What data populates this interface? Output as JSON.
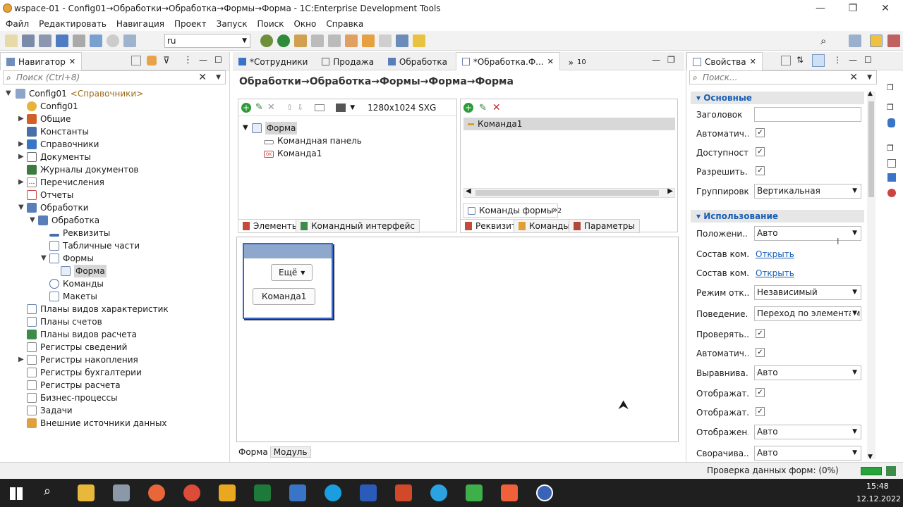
{
  "window": {
    "title": "wspace-01 - Config01→Обработки→Обработка→Формы→Форма - 1C:Enterprise Development Tools"
  },
  "menu": [
    "Файл",
    "Редактировать",
    "Навигация",
    "Проект",
    "Запуск",
    "Поиск",
    "Окно",
    "Справка"
  ],
  "toolbar": {
    "language": "ru"
  },
  "navigator": {
    "tab": "Навигатор",
    "search_placeholder": "Поиск (Ctrl+8)",
    "root": "Config01",
    "root_suffix": "<Справочники>",
    "items": [
      {
        "label": "Config01"
      },
      {
        "label": "Общие"
      },
      {
        "label": "Константы"
      },
      {
        "label": "Справочники"
      },
      {
        "label": "Документы"
      },
      {
        "label": "Журналы документов"
      },
      {
        "label": "Перечисления"
      },
      {
        "label": "Отчеты"
      },
      {
        "label": "Обработки"
      },
      {
        "label": "Обработка"
      },
      {
        "label": "Реквизиты"
      },
      {
        "label": "Табличные части"
      },
      {
        "label": "Формы"
      },
      {
        "label": "Форма"
      },
      {
        "label": "Команды"
      },
      {
        "label": "Макеты"
      },
      {
        "label": "Планы видов характеристик"
      },
      {
        "label": "Планы счетов"
      },
      {
        "label": "Планы видов расчета"
      },
      {
        "label": "Регистры сведений"
      },
      {
        "label": "Регистры накопления"
      },
      {
        "label": "Регистры бухгалтерии"
      },
      {
        "label": "Регистры расчета"
      },
      {
        "label": "Бизнес-процессы"
      },
      {
        "label": "Задачи"
      },
      {
        "label": "Внешние источники данных"
      }
    ]
  },
  "editor": {
    "tabs": [
      "*Сотрудники",
      "Продажа",
      "Обработка",
      "*Обработка.Ф...",
      "10"
    ],
    "breadcrumb": "Обработки→Обработка→Формы→Форма→Форма",
    "resolution": "1280x1024 SXG",
    "tree": [
      "Форма",
      "Командная панель",
      "Команда1"
    ],
    "left_tabs": [
      "Элементы",
      "Командный интерфейс"
    ],
    "command_list": [
      "Команда1"
    ],
    "command_sub_tab": "Команды формы",
    "command_sub_more": "2",
    "right_tabs": [
      "Реквизит",
      "Команды",
      "Параметры"
    ],
    "preview": {
      "more_button": "Ещё",
      "command_button": "Команда1"
    },
    "bottom_tabs": [
      "Форма",
      "Модуль"
    ]
  },
  "properties": {
    "tab": "Свойства",
    "search_placeholder": "Поиск...",
    "section_main": "Основные",
    "section_usage": "Использование",
    "rows_main": [
      {
        "label": "Заголовок",
        "type": "input",
        "value": ""
      },
      {
        "label": "Автоматич...",
        "type": "check",
        "value": "✓"
      },
      {
        "label": "Доступность",
        "type": "check",
        "value": "✓"
      },
      {
        "label": "Разрешить...",
        "type": "check",
        "value": "✓"
      },
      {
        "label": "Группировка",
        "type": "select",
        "value": "Вертикальная"
      }
    ],
    "rows_usage": [
      {
        "label": "Положени...",
        "type": "select",
        "value": "Авто"
      },
      {
        "label": "Состав ком...",
        "type": "link",
        "value": "Открыть"
      },
      {
        "label": "Состав ком...",
        "type": "link",
        "value": "Открыть"
      },
      {
        "label": "Режим отк...",
        "type": "select",
        "value": "Независимый"
      },
      {
        "label": "Поведение...",
        "type": "select",
        "value": "Переход по элементам"
      },
      {
        "label": "Проверять...",
        "type": "check",
        "value": "✓"
      },
      {
        "label": "Автоматич...",
        "type": "check",
        "value": "✓"
      },
      {
        "label": "Выравнива...",
        "type": "select",
        "value": "Авто"
      },
      {
        "label": "Отображат...",
        "type": "check",
        "value": "✓"
      },
      {
        "label": "Отображат...",
        "type": "check",
        "value": "✓"
      },
      {
        "label": "Отображен...",
        "type": "select",
        "value": "Авто"
      },
      {
        "label": "Сворачива...",
        "type": "select",
        "value": "Авто"
      }
    ]
  },
  "status": {
    "text": "Проверка данных форм: (0%)"
  },
  "taskbar": {
    "time": "15:48",
    "date": "12.12.2022"
  }
}
